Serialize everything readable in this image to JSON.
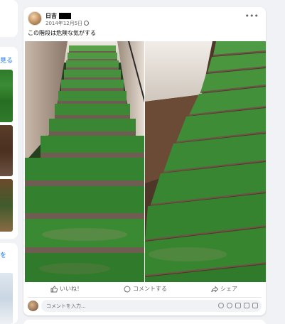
{
  "left": {
    "see_more_1": "見る",
    "see_more_2": "を"
  },
  "post": {
    "author_name": "日吉",
    "timestamp": "2014年12月5日",
    "caption": "この階段は危険な気がする",
    "more_icon": "more-dots-icon",
    "privacy_icon": "globe-icon"
  },
  "actions": {
    "like": "いいね！",
    "comment": "コメントする",
    "share": "シェア"
  },
  "comment_box": {
    "placeholder": "コメントを入力..."
  },
  "colors": {
    "accent": "#1877f2",
    "stair_green": "#3a8f3a",
    "secondary_text": "#65676b"
  }
}
